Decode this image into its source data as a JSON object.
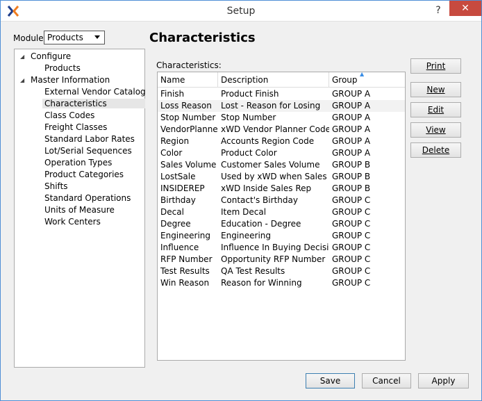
{
  "window": {
    "title": "Setup",
    "help": "?",
    "close": "✕"
  },
  "module": {
    "label": "Module:",
    "selected": "Products"
  },
  "tree": {
    "configure": "Configure",
    "configure_children": [
      "Products"
    ],
    "master": "Master Information",
    "master_children": [
      "External Vendor Catalog",
      "Characteristics",
      "Class Codes",
      "Freight Classes",
      "Standard Labor Rates",
      "Lot/Serial Sequences",
      "Operation Types",
      "Product Categories",
      "Shifts",
      "Standard Operations",
      "Units of Measure",
      "Work Centers"
    ]
  },
  "main": {
    "heading": "Characteristics",
    "table_label": "Characteristics:",
    "columns": [
      "Name",
      "Description",
      "Group"
    ],
    "rows": [
      [
        "Finish",
        "Product Finish",
        "GROUP A"
      ],
      [
        "Loss Reason",
        "Lost - Reason for Losing",
        "GROUP A"
      ],
      [
        "Stop Number",
        "Stop Number",
        "GROUP A"
      ],
      [
        "VendorPlanner",
        "xWD Vendor Planner Code",
        "GROUP A"
      ],
      [
        "Region",
        "Accounts Region Code",
        "GROUP A"
      ],
      [
        "Color",
        "Product Color",
        "GROUP A"
      ],
      [
        "Sales Volume",
        "Customer Sales Volume",
        "GROUP B"
      ],
      [
        "LostSale",
        "Used by xWD when Sales O...",
        "GROUP B"
      ],
      [
        "INSIDEREP",
        "xWD Inside Sales Rep",
        "GROUP B"
      ],
      [
        "Birthday",
        "Contact's Birthday",
        "GROUP C"
      ],
      [
        "Decal",
        "Item Decal",
        "GROUP C"
      ],
      [
        "Degree",
        "Education - Degree",
        "GROUP C"
      ],
      [
        "Engineering",
        "Engineering",
        "GROUP C"
      ],
      [
        "Influence",
        "Influence In Buying Decisio...",
        "GROUP C"
      ],
      [
        "RFP Number",
        "Opportunity RFP Number",
        "GROUP C"
      ],
      [
        "Test Results",
        "QA Test Results",
        "GROUP C"
      ],
      [
        "Win Reason",
        "Reason for Winning",
        "GROUP C"
      ]
    ]
  },
  "side_buttons": [
    "Print",
    "New",
    "Edit",
    "View",
    "Delete"
  ],
  "bottom_buttons": {
    "save": "Save",
    "cancel": "Cancel",
    "apply": "Apply"
  },
  "colors": {
    "accent": "#3a8ee6",
    "close": "#c74a3f",
    "selected_row": "#e6e6e6"
  }
}
